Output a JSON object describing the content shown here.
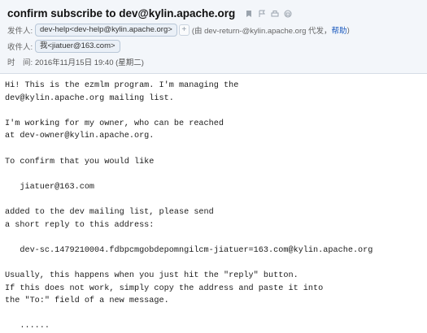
{
  "email": {
    "subject": "confirm subscribe to dev@kylin.apache.org",
    "icons": [
      "bookmark-icon",
      "flag-icon",
      "print-icon",
      "mail-icon"
    ],
    "from_label": "发件人:",
    "from_chip": "dev-help<dev-help@kylin.apache.org>",
    "from_plus": "+",
    "via_text": "(由 dev-return-@kylin.apache.org 代发，",
    "help_link": "帮助",
    "via_close": ")",
    "to_label": "收件人:",
    "to_chip": "我<jiatuer@163.com>",
    "time_label": "时　间:",
    "time_value": "2016年11月15日 19:40 (星期二)"
  },
  "body_lines": [
    "Hi! This is the ezmlm program. I'm managing the",
    "dev@kylin.apache.org mailing list.",
    "",
    "I'm working for my owner, who can be reached",
    "at dev-owner@kylin.apache.org.",
    "",
    "To confirm that you would like",
    "",
    "   jiatuer@163.com",
    "",
    "added to the dev mailing list, please send",
    "a short reply to this address:",
    "",
    "   dev-sc.1479210004.fdbpcmgobdepomngilcm-jiatuer=163.com@kylin.apache.org",
    "",
    "Usually, this happens when you just hit the \"reply\" button.",
    "If this does not work, simply copy the address and paste it into",
    "the \"To:\" field of a new message.",
    "",
    "   ......"
  ]
}
